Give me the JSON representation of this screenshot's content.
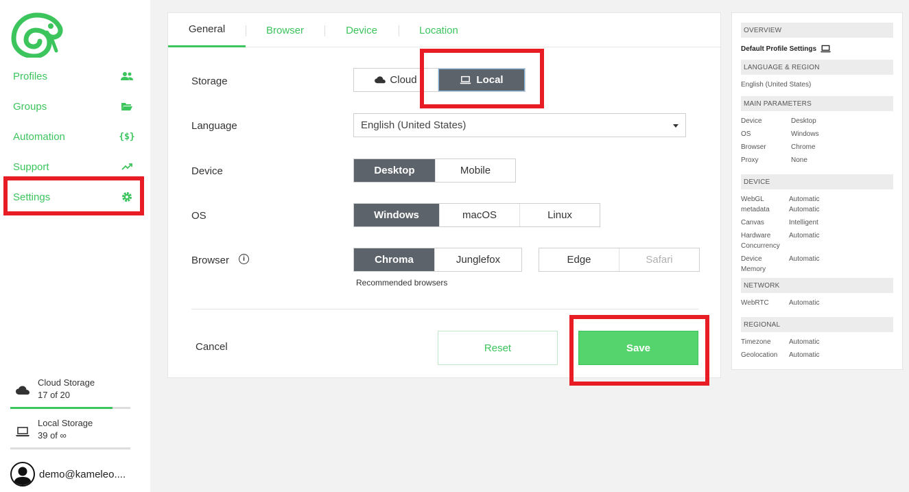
{
  "sidebar": {
    "nav": [
      {
        "label": "Profiles",
        "icon": "users-icon"
      },
      {
        "label": "Groups",
        "icon": "folder-open-icon"
      },
      {
        "label": "Automation",
        "icon": "code-braces-icon"
      },
      {
        "label": "Support",
        "icon": "trend-up-icon"
      },
      {
        "label": "Settings",
        "icon": "gear-icon"
      }
    ],
    "cloud_storage": {
      "title": "Cloud Storage",
      "count": "17 of 20",
      "fill": 0.85
    },
    "local_storage": {
      "title": "Local Storage",
      "count": "39 of ∞",
      "fill": 1.0
    },
    "user": {
      "email": "demo@kameleo...."
    }
  },
  "tabs": [
    "General",
    "Browser",
    "Device",
    "Location"
  ],
  "form": {
    "storage": {
      "label": "Storage",
      "options": [
        "Cloud",
        "Local"
      ],
      "selected": "Local"
    },
    "language": {
      "label": "Language",
      "value": "English (United States)"
    },
    "device": {
      "label": "Device",
      "options": [
        "Desktop",
        "Mobile"
      ],
      "selected": "Desktop"
    },
    "os": {
      "label": "OS",
      "options": [
        "Windows",
        "macOS",
        "Linux"
      ],
      "selected": "Windows"
    },
    "browser": {
      "label": "Browser",
      "recommended": [
        "Chroma",
        "Junglefox"
      ],
      "others": [
        "Edge",
        "Safari"
      ],
      "selected": "Chroma",
      "note": "Recommended browsers"
    },
    "cancel": "Cancel",
    "reset": "Reset",
    "save": "Save"
  },
  "overview": {
    "head": "OVERVIEW",
    "default_title": "Default Profile Settings",
    "lang_head": "LANGUAGE & REGION",
    "lang_value": "English (United States)",
    "main_head": "MAIN PARAMETERS",
    "main": [
      {
        "k": "Device",
        "v": "Desktop"
      },
      {
        "k": "OS",
        "v": "Windows"
      },
      {
        "k": "Browser",
        "v": "Chrome"
      },
      {
        "k": "Proxy",
        "v": "None"
      }
    ],
    "device_head": "DEVICE",
    "device": [
      {
        "k": "WebGL",
        "v": "Automatic"
      },
      {
        "k": "metadata",
        "v": "Automatic"
      },
      {
        "k": "Canvas",
        "v": "Intelligent"
      },
      {
        "k": "Hardware",
        "v": "Automatic"
      },
      {
        "k": "Concurrency",
        "v": ""
      },
      {
        "k": "Device",
        "v": "Automatic"
      },
      {
        "k": "Memory",
        "v": ""
      }
    ],
    "network_head": "NETWORK",
    "network": [
      {
        "k": "WebRTC",
        "v": "Automatic"
      }
    ],
    "regional_head": "REGIONAL",
    "regional": [
      {
        "k": "Timezone",
        "v": "Automatic"
      },
      {
        "k": "Geolocation",
        "v": "Automatic"
      }
    ]
  },
  "colors": {
    "accent": "#3cc45d",
    "highlight": "#e81c24",
    "selected": "#5d636a"
  }
}
